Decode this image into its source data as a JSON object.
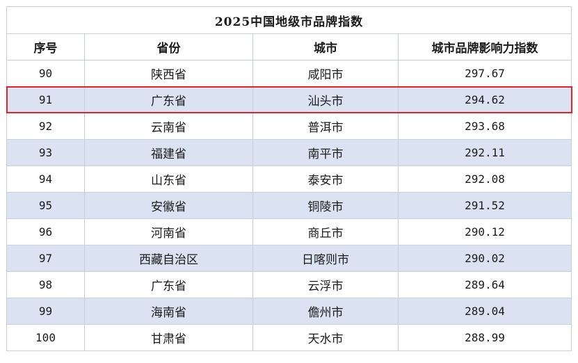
{
  "table": {
    "title": "2025中国地级市品牌指数",
    "headers": [
      "序号",
      "省份",
      "城市",
      "城市品牌影响力指数"
    ],
    "rows": [
      [
        "90",
        "陕西省",
        "咸阳市",
        "297.67"
      ],
      [
        "91",
        "广东省",
        "汕头市",
        "294.62"
      ],
      [
        "92",
        "云南省",
        "普洱市",
        "293.68"
      ],
      [
        "93",
        "福建省",
        "南平市",
        "292.11"
      ],
      [
        "94",
        "山东省",
        "泰安市",
        "292.08"
      ],
      [
        "95",
        "安徽省",
        "铜陵市",
        "291.52"
      ],
      [
        "96",
        "河南省",
        "商丘市",
        "290.12"
      ],
      [
        "97",
        "西藏自治区",
        "日喀则市",
        "290.02"
      ],
      [
        "98",
        "广东省",
        "云浮市",
        "289.64"
      ],
      [
        "99",
        "海南省",
        "儋州市",
        "289.04"
      ],
      [
        "100",
        "甘肃省",
        "天水市",
        "288.99"
      ]
    ],
    "highlight_row_index": 1,
    "highlight_color": "#e2232a",
    "stripe_color": "#dbe2f1"
  }
}
